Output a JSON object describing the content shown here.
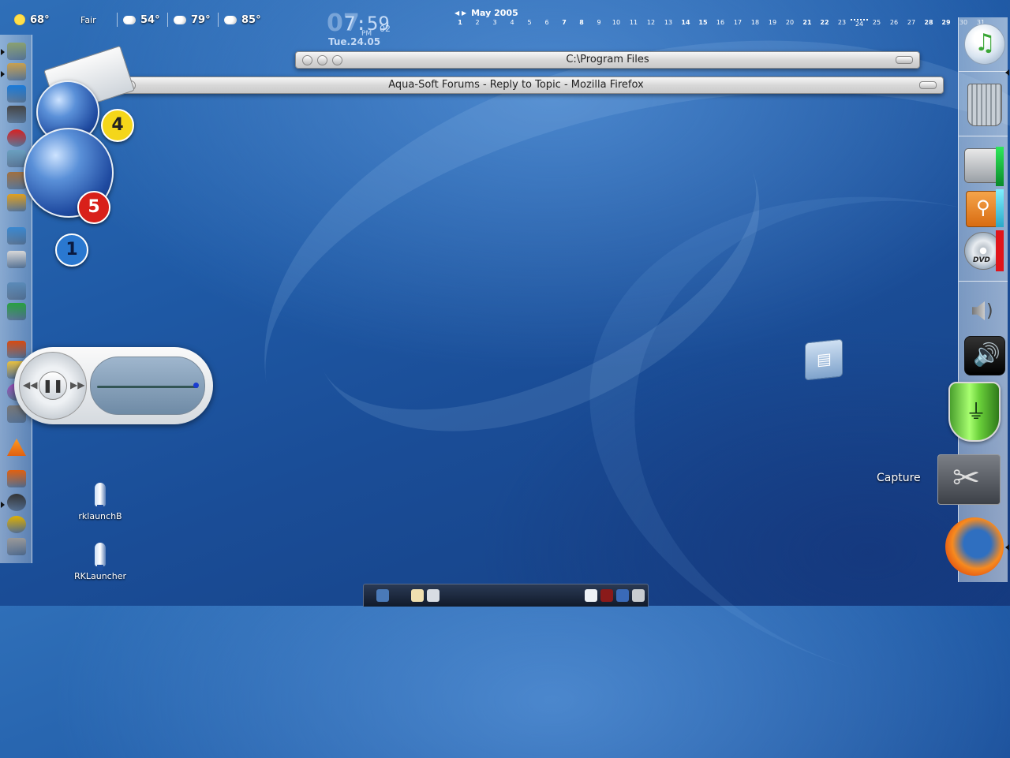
{
  "weather": [
    {
      "condition_icon": "sun-icon",
      "temp": "68°",
      "label": "Fair"
    },
    {
      "condition_icon": "cloud-icon",
      "temp": "54°"
    },
    {
      "condition_icon": "cloud-sun-icon",
      "temp": "79°"
    },
    {
      "condition_icon": "cloud-sun-icon",
      "temp": "85°"
    }
  ],
  "clock": {
    "big_digit": "07",
    "time": "7:59",
    "seconds": "02",
    "ampm": "PM",
    "date": "Tue.24.05"
  },
  "calendar": {
    "title": "May 2005",
    "nav_arrows": "◀ ▶",
    "days": [
      "1",
      "2",
      "3",
      "4",
      "5",
      "6",
      "7",
      "8",
      "9",
      "10",
      "11",
      "12",
      "13",
      "14",
      "15",
      "16",
      "17",
      "18",
      "19",
      "20",
      "21",
      "22",
      "23",
      "24",
      "25",
      "26",
      "27",
      "28",
      "29",
      "30",
      "31"
    ],
    "bold_days": [
      "1",
      "7",
      "8",
      "14",
      "15",
      "21",
      "22",
      "28",
      "29"
    ],
    "today": "24"
  },
  "windows": [
    {
      "title": "C:\\Program Files"
    },
    {
      "title": "Aqua-Soft Forums - Reply to Topic - Mozilla Firefox"
    }
  ],
  "left_dock_icons": [
    "terminal-icon",
    "network-icon",
    "internet-explorer-icon",
    "floppy-save-icon",
    "skype-icon",
    "tools-icon",
    "rabbit-icon",
    "office-icon",
    "word-icon",
    "acrobat-icon",
    "network-computers-icon",
    "phone-icon",
    "powerpoint-icon",
    "paint-icon",
    "picasa-icon",
    "film-reel-icon",
    "vlc-cone-icon",
    "radio-icon",
    "steam-icon",
    "winamp-icon",
    "system-icon"
  ],
  "mail_badges": {
    "globe_small": "4",
    "globe_large": "5",
    "third": "1"
  },
  "right_dock": {
    "capture_label": "Capture"
  },
  "desktop_icons": [
    {
      "label": "rklaunchB"
    },
    {
      "label": "RKLauncher"
    }
  ],
  "colors": {
    "badge_yellow": "#f4d61a",
    "badge_red": "#d8201a",
    "badge_blue": "#2a78d0"
  }
}
